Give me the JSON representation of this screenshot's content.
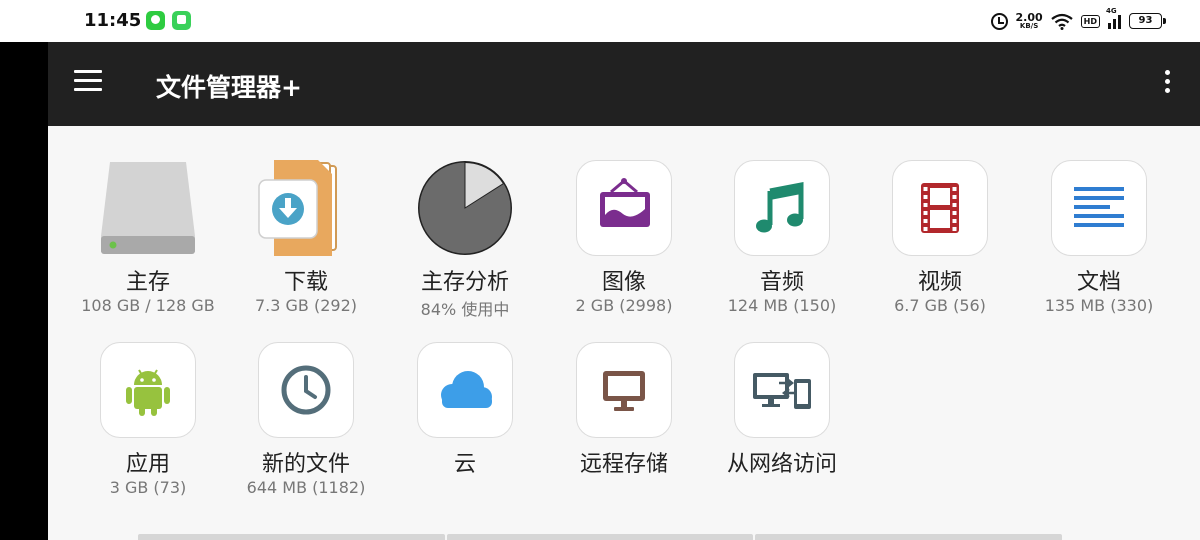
{
  "status_bar": {
    "time": "11:45",
    "net_speed_value": "2.00",
    "net_speed_unit": "KB/S",
    "hd_label": "HD",
    "signal_label": "4G",
    "battery": "93",
    "notification_icons": [
      "message-app-icon",
      "chat-app-icon"
    ]
  },
  "toolbar": {
    "title": "文件管理器+",
    "menu_icon": "hamburger-menu-icon",
    "overflow_icon": "more-vert-icon"
  },
  "categories": [
    {
      "id": "main-storage",
      "label": "主存",
      "sub": "108 GB / 128 GB",
      "icon": "hard-drive-icon"
    },
    {
      "id": "downloads",
      "label": "下载",
      "sub": "7.3 GB (292)",
      "icon": "download-folder-icon"
    },
    {
      "id": "storage-analysis",
      "label": "主存分析",
      "sub": "84% 使用中",
      "icon": "pie-chart-icon",
      "used_fraction": 0.84
    },
    {
      "id": "images",
      "label": "图像",
      "sub": "2 GB (2998)",
      "icon": "image-icon",
      "accent": "#7b2d8e"
    },
    {
      "id": "audio",
      "label": "音频",
      "sub": "124 MB (150)",
      "icon": "music-note-icon",
      "accent": "#1f8a6e"
    },
    {
      "id": "video",
      "label": "视频",
      "sub": "6.7 GB (56)",
      "icon": "film-icon",
      "accent": "#b2282c"
    },
    {
      "id": "documents",
      "label": "文档",
      "sub": "135 MB (330)",
      "icon": "document-lines-icon",
      "accent": "#2f7dd1"
    },
    {
      "id": "apps",
      "label": "应用",
      "sub": "3 GB (73)",
      "icon": "android-icon",
      "accent": "#97c23e"
    },
    {
      "id": "recent",
      "label": "新的文件",
      "sub": "644 MB (1182)",
      "icon": "clock-icon",
      "accent": "#546e7a"
    },
    {
      "id": "cloud",
      "label": "云",
      "sub": "",
      "icon": "cloud-icon",
      "accent": "#3d9ee8"
    },
    {
      "id": "remote",
      "label": "远程存储",
      "sub": "",
      "icon": "monitor-icon",
      "accent": "#7a5548"
    },
    {
      "id": "network",
      "label": "从网络访问",
      "sub": "",
      "icon": "computer-phone-icon",
      "accent": "#455a64"
    }
  ]
}
